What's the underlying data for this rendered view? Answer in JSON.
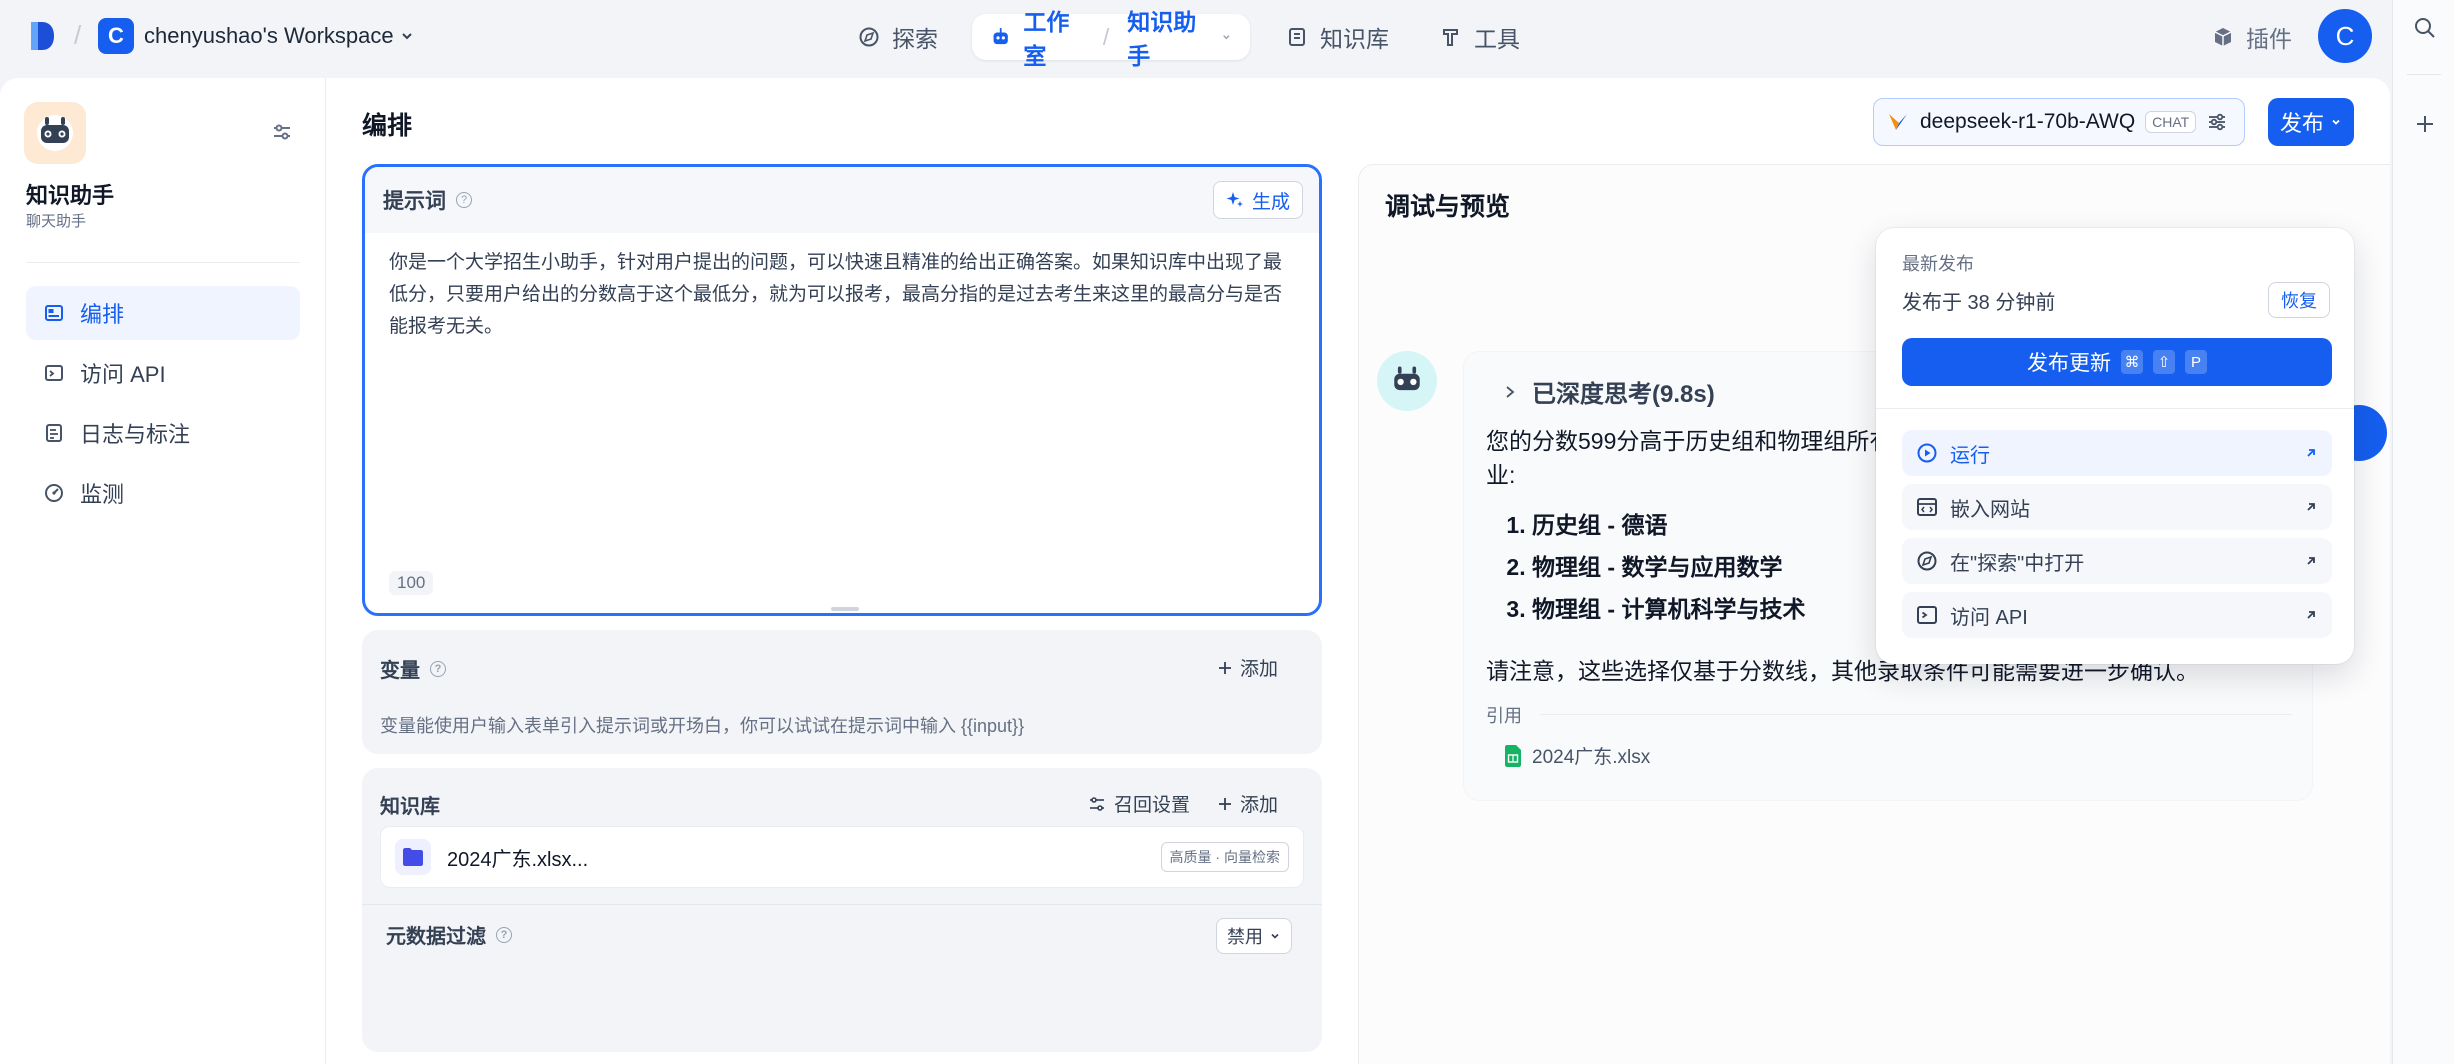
{
  "topbar": {
    "workspace_initial": "C",
    "workspace_name": "chenyushao's Workspace",
    "nav_explore": "探索",
    "nav_studio": "工作室",
    "nav_app": "知识助手",
    "nav_knowledge": "知识库",
    "nav_tools": "工具",
    "nav_plugins": "插件",
    "user_initial": "C"
  },
  "app": {
    "name": "知识助手",
    "type": "聊天助手"
  },
  "sidebar": {
    "items": [
      {
        "label": "编排",
        "icon": "layout-icon",
        "active": true
      },
      {
        "label": "访问 API",
        "icon": "terminal-icon",
        "active": false
      },
      {
        "label": "日志与标注",
        "icon": "log-icon",
        "active": false
      },
      {
        "label": "监测",
        "icon": "monitor-icon",
        "active": false
      }
    ]
  },
  "page_title": "编排",
  "model": {
    "name": "deepseek-r1-70b-AWQ",
    "tag": "CHAT"
  },
  "publish_label": "发布",
  "prompt": {
    "label": "提示词",
    "generate_label": "生成",
    "text": "你是一个大学招生小助手，针对用户提出的问题，可以快速且精准的给出正确答案。如果知识库中出现了最低分，只要用户给出的分数高于这个最低分，就为可以报考，最高分指的是过去考生来这里的最高分与是否能报考无关。",
    "count": "100"
  },
  "variables": {
    "label": "变量",
    "add_label": "添加",
    "description": "变量能使用户输入表单引入提示词或开场白，你可以试试在提示词中输入 {{input}}"
  },
  "knowledge": {
    "label": "知识库",
    "recall_label": "召回设置",
    "add_label": "添加",
    "item_name": "2024广东.xlsx...",
    "item_tag": "高质量 · 向量检索",
    "metadata_label": "元数据过滤",
    "metadata_value": "禁用"
  },
  "preview": {
    "title": "调试与预览",
    "thinking": "已深度思考(9.8s)",
    "answer_intro": "您的分数599分高于历史组和物理组所有",
    "answer_intro_end": "业:",
    "answer_items": [
      "历史组 - 德语",
      "物理组 - 数学与应用数学",
      "物理组 - 计算机科学与技术"
    ],
    "answer_note": "请注意，这些选择仅基于分数线，其他录取条件可能需要进一步确认。",
    "reference_label": "引用",
    "reference_file": "2024广东.xlsx"
  },
  "dropdown": {
    "title": "最新发布",
    "published_time": "发布于 38 分钟前",
    "restore_label": "恢复",
    "update_label": "发布更新",
    "shortcut_keys": [
      "⌘",
      "⇧",
      "P"
    ],
    "items": [
      {
        "label": "运行",
        "icon": "play-icon",
        "active": true
      },
      {
        "label": "嵌入网站",
        "icon": "embed-icon",
        "active": false
      },
      {
        "label": "在\"探索\"中打开",
        "icon": "compass-icon",
        "active": false
      },
      {
        "label": "访问 API",
        "icon": "terminal-icon",
        "active": false
      }
    ]
  },
  "colors": {
    "primary": "#155eef",
    "active_bg": "#eff4ff",
    "border_focus": "#2970ff"
  }
}
